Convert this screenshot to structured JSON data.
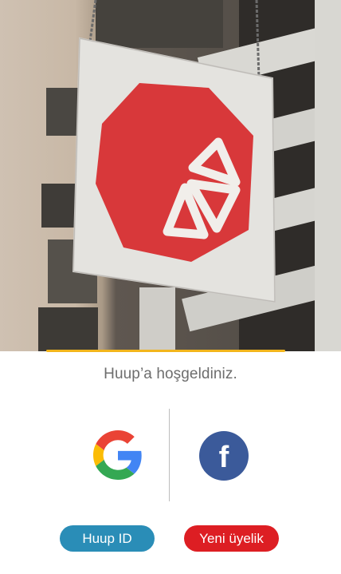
{
  "welcome": {
    "text": "Huup’a hoşgeldiniz."
  },
  "social_login": {
    "google_icon": "google-g-icon",
    "facebook_icon": "facebook-f-icon",
    "facebook_letter": "f"
  },
  "buttons": {
    "huup_id_label": "Huup ID",
    "signup_label": "Yeni üyelik"
  },
  "colors": {
    "accent_line": "#f2b51c",
    "huup_id_button": "#2a8db7",
    "signup_button": "#dd1e23",
    "facebook_blue": "#3b5a9a",
    "logo_red": "#d8383a"
  }
}
